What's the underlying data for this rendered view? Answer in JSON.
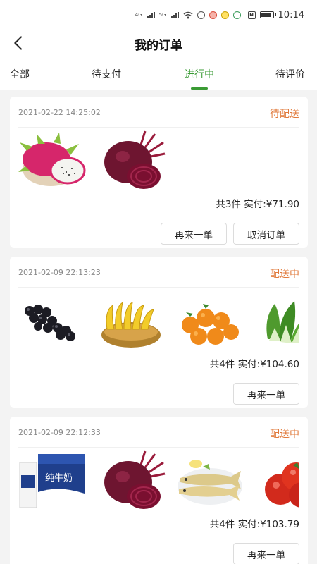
{
  "status_bar": {
    "time": "10:14",
    "net1": "4G",
    "net2": "5G",
    "icons": [
      "signal-icon",
      "signal-icon",
      "wifi-icon",
      "alarm-icon",
      "notification-icon",
      "app-icon",
      "app-icon",
      "nfc-icon",
      "battery-icon"
    ]
  },
  "header": {
    "title": "我的订单",
    "back_icon": "back-arrow-icon"
  },
  "tabs": {
    "items": [
      "全部",
      "待支付",
      "进行中",
      "待评价"
    ],
    "active": "进行中"
  },
  "colors": {
    "accent": "#3a9b34",
    "status": "#e07a3b"
  },
  "orders": [
    {
      "date": "2021-02-22 14:25:02",
      "status": "待配送",
      "items": [
        "dragon-fruit",
        "beetroot"
      ],
      "summary": "共3件 实付:¥71.90",
      "buttons": [
        "再来一单",
        "取消订单"
      ]
    },
    {
      "date": "2021-02-09 22:13:23",
      "status": "配送中",
      "items": [
        "grapes",
        "bananas",
        "oranges",
        "bok-choy"
      ],
      "summary": "共4件 实付:¥104.60",
      "buttons": [
        "再来一单"
      ]
    },
    {
      "date": "2021-02-09 22:12:33",
      "status": "配送中",
      "items": [
        "milk-box",
        "beetroot",
        "yellow-croaker-fish",
        "tomatoes"
      ],
      "summary": "共4件 实付:¥103.79",
      "buttons": [
        "再来一单"
      ],
      "milk_label": "纯牛奶"
    }
  ]
}
